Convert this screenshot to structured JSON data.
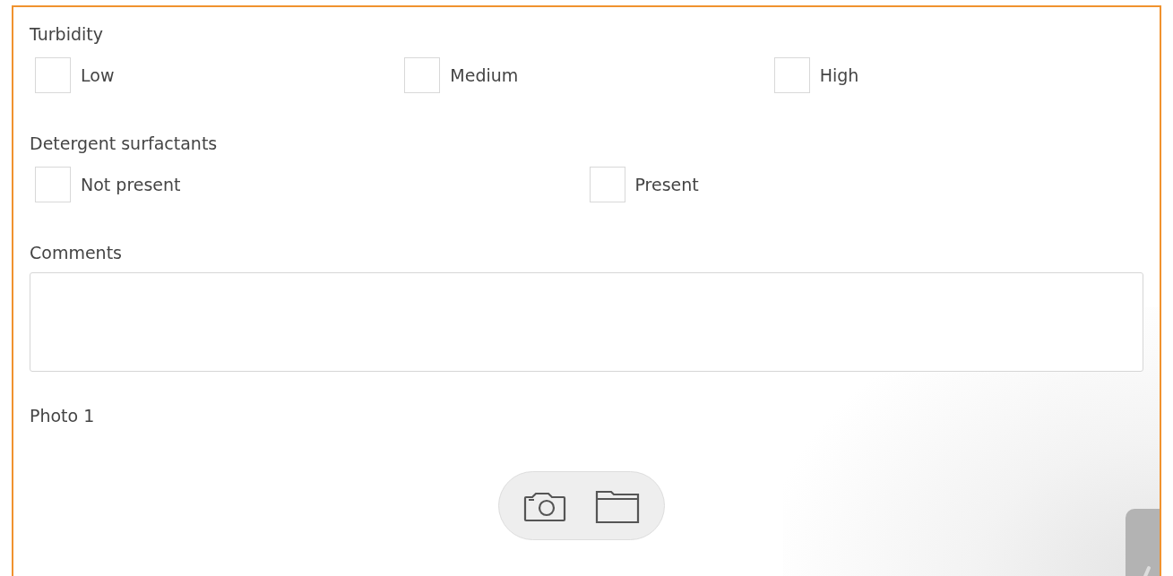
{
  "questions": [
    {
      "label": "Turbidity",
      "kind": "checkboxes",
      "options": [
        {
          "label": "Low",
          "checked": false
        },
        {
          "label": "Medium",
          "checked": false
        },
        {
          "label": "High",
          "checked": false
        }
      ]
    },
    {
      "label": "Detergent surfactants",
      "kind": "checkboxes",
      "options": [
        {
          "label": "Not present",
          "checked": false
        },
        {
          "label": "Present",
          "checked": false
        }
      ]
    },
    {
      "label": "Comments",
      "kind": "text"
    },
    {
      "label": "Photo 1",
      "kind": "photo"
    }
  ]
}
